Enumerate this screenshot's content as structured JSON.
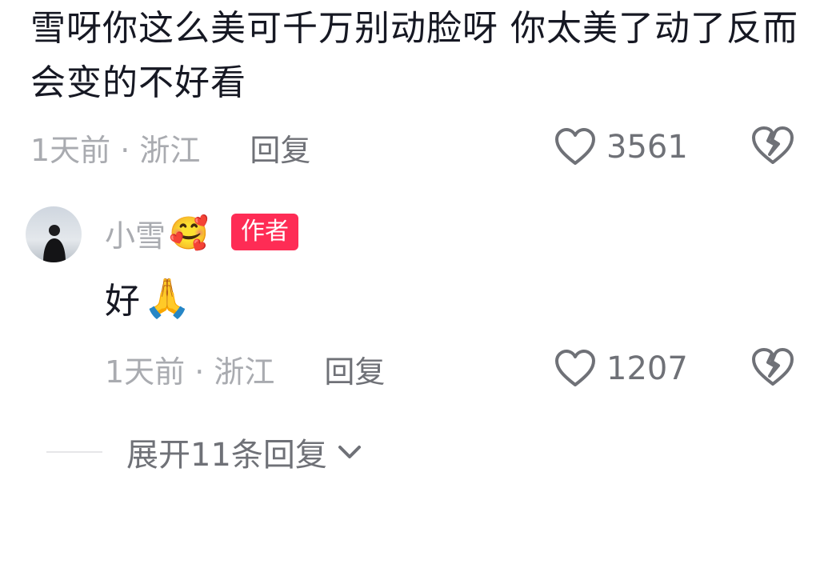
{
  "comment": {
    "text": "雪呀你这么美可千万别动脸呀  你太美了动了反而会变的不好看",
    "time_location": "1天前 · 浙江",
    "reply_label": "回复",
    "like_count": "3561"
  },
  "reply": {
    "author_name": "小雪",
    "author_emoji": "🥰",
    "author_badge": "作者",
    "text": "好",
    "text_emoji": "🙏",
    "time_location": "1天前 · 浙江",
    "reply_label": "回复",
    "like_count": "1207"
  },
  "expand": {
    "label": "展开11条回复"
  },
  "icons": {
    "like": "heart-outline-icon",
    "dislike": "broken-heart-icon",
    "expand": "chevron-down-icon"
  },
  "colors": {
    "badge": "#fe2c55",
    "text_primary": "#161823",
    "text_secondary": "#a9abb0",
    "text_tertiary": "#6f7177"
  }
}
